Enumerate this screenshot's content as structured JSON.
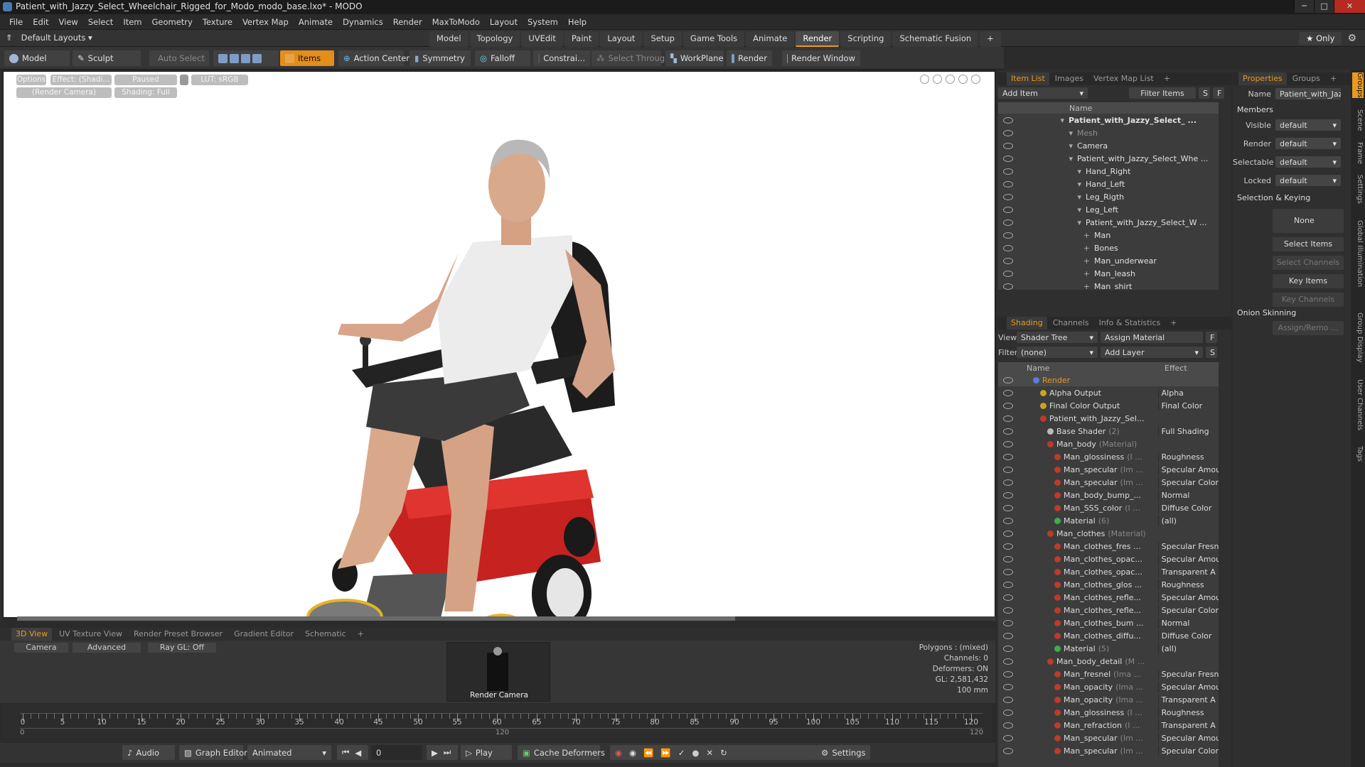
{
  "window": {
    "title": "Patient_with_Jazzy_Select_Wheelchair_Rigged_for_Modo_modo_base.lxo* - MODO",
    "min": "─",
    "max": "□",
    "close": "✕"
  },
  "menu": [
    "File",
    "Edit",
    "View",
    "Select",
    "Item",
    "Geometry",
    "Texture",
    "Vertex Map",
    "Animate",
    "Dynamics",
    "Render",
    "MaxToModo",
    "Layout",
    "System",
    "Help"
  ],
  "layoutbar": {
    "layouts_label": "Default Layouts ▾",
    "tabs": [
      "Model",
      "Topology",
      "UVEdit",
      "Paint",
      "Layout",
      "Setup",
      "Game Tools",
      "Animate",
      "Render",
      "Scripting",
      "Schematic Fusion"
    ],
    "active_tab": "Render",
    "add": "+",
    "only": "★ Only",
    "gear": "⚙"
  },
  "toolbar": {
    "model": "Model",
    "sculpt": "Sculpt",
    "auto_select": "Auto Select",
    "items": "Items",
    "action_center": "Action Center",
    "symmetry": "Symmetry",
    "falloff": "Falloff",
    "constraints": "Constrai...",
    "select_through": "Select Through",
    "workplane": "WorkPlane",
    "render": "Render",
    "render_window": "Render Window"
  },
  "viewport": {
    "tags": [
      "Options",
      "Effect: (Shadi...",
      "Paused",
      "LUT: sRGB",
      "(Render Camera)",
      "Shading: Full"
    ]
  },
  "bottom_tabs": [
    "3D View",
    "UV Texture View",
    "Render Preset Browser",
    "Gradient Editor",
    "Schematic",
    "+"
  ],
  "bottom_view": {
    "camera": "Camera",
    "advanced": "Advanced",
    "raygl": "Ray GL: Off",
    "thumb_label": "Render Camera",
    "stats": [
      "Polygons : (mixed)",
      "Channels: 0",
      "Deformers: ON",
      "GL: 2,581,432",
      "100 mm"
    ]
  },
  "timeline": {
    "ticks": [
      0,
      5,
      10,
      15,
      20,
      25,
      30,
      35,
      40,
      45,
      50,
      55,
      60,
      65,
      70,
      75,
      80,
      85,
      90,
      95,
      100,
      105,
      110,
      115,
      120
    ],
    "sub_start": "0",
    "sub_mid": "120",
    "sub_end": "120"
  },
  "transport": {
    "audio": "Audio",
    "graph_editor": "Graph Editor",
    "animated": "Animated",
    "frame": "0",
    "play": "Play",
    "cache_deformers": "Cache Deformers",
    "settings": "Settings"
  },
  "item_list": {
    "tabs": [
      "Item List",
      "Images",
      "Vertex Map List",
      "+"
    ],
    "add_item": "Add Item",
    "filter_items": "Filter Items",
    "s": "S",
    "f": "F",
    "header": "Name",
    "rows": [
      {
        "name": "Patient_with_Jazzy_Select_ ...",
        "bold": true,
        "indent": 0
      },
      {
        "name": "Mesh",
        "dim": true,
        "indent": 1
      },
      {
        "name": "Camera",
        "indent": 1
      },
      {
        "name": "Patient_with_Jazzy_Select_Whe ...",
        "indent": 1
      },
      {
        "name": "Hand_Right",
        "indent": 2
      },
      {
        "name": "Hand_Left",
        "indent": 2
      },
      {
        "name": "Leg_Rigth",
        "indent": 2
      },
      {
        "name": "Leg_Left",
        "indent": 2
      },
      {
        "name": "Patient_with_Jazzy_Select_W ...",
        "indent": 2
      },
      {
        "name": "Man",
        "indent": 3
      },
      {
        "name": "Bones",
        "indent": 3
      },
      {
        "name": "Man_underwear",
        "indent": 3
      },
      {
        "name": "Man_leash",
        "indent": 3
      },
      {
        "name": "Man_shirt",
        "indent": 3
      }
    ]
  },
  "shading": {
    "tabs": [
      "Shading",
      "Channels",
      "Info & Statistics",
      "+"
    ],
    "view_label": "View",
    "view_value": "Shader Tree",
    "assign_material": "Assign Material",
    "filter_label": "Filter",
    "filter_value": "(none)",
    "add_layer": "Add Layer",
    "col_name": "Name",
    "col_effect": "Effect",
    "rows": [
      {
        "name": "Render",
        "effect": "",
        "indent": 0,
        "dot": "#5a7fd6",
        "orange": true
      },
      {
        "name": "Alpha Output",
        "effect": "Alpha",
        "indent": 1,
        "dot": "#c9a227"
      },
      {
        "name": "Final Color Output",
        "effect": "Final Color",
        "indent": 1,
        "dot": "#c9a227"
      },
      {
        "name": "Patient_with_Jazzy_Sel...",
        "effect": "",
        "indent": 1,
        "dot": "#c0392b"
      },
      {
        "name": "Base Shader",
        "sub": "(2)",
        "effect": "Full Shading",
        "indent": 2,
        "dot": "#bbbbbb"
      },
      {
        "name": "Man_body",
        "sub": "(Material)",
        "effect": "",
        "indent": 2,
        "dot": "#c0392b"
      },
      {
        "name": "Man_glossiness",
        "sub": "(I ...",
        "effect": "Roughness",
        "indent": 3,
        "dot": "#c0392b"
      },
      {
        "name": "Man_specular",
        "sub": "(Im ...",
        "effect": "Specular Amou ...",
        "indent": 3,
        "dot": "#c0392b"
      },
      {
        "name": "Man_specular",
        "sub": "(Im ...",
        "effect": "Specular Color",
        "indent": 3,
        "dot": "#c0392b"
      },
      {
        "name": "Man_body_bump_...",
        "effect": "Normal",
        "indent": 3,
        "dot": "#c0392b"
      },
      {
        "name": "Man_SSS_color",
        "sub": "(I ...",
        "effect": "Diffuse Color",
        "indent": 3,
        "dot": "#c0392b"
      },
      {
        "name": "Material",
        "sub": "(6)",
        "effect": "(all)",
        "indent": 3,
        "dot": "#3fae4a"
      },
      {
        "name": "Man_clothes",
        "sub": "(Material)",
        "effect": "",
        "indent": 2,
        "dot": "#c0392b"
      },
      {
        "name": "Man_clothes_fres ...",
        "effect": "Specular Fresnel",
        "indent": 3,
        "dot": "#c0392b"
      },
      {
        "name": "Man_clothes_opac...",
        "effect": "Specular Amou ...",
        "indent": 3,
        "dot": "#c0392b"
      },
      {
        "name": "Man_clothes_opac...",
        "effect": "Transparent A ...",
        "indent": 3,
        "dot": "#c0392b"
      },
      {
        "name": "Man_clothes_glos ...",
        "effect": "Roughness",
        "indent": 3,
        "dot": "#c0392b"
      },
      {
        "name": "Man_clothes_refle...",
        "effect": "Specular Amou ...",
        "indent": 3,
        "dot": "#c0392b"
      },
      {
        "name": "Man_clothes_refle...",
        "effect": "Specular Color",
        "indent": 3,
        "dot": "#c0392b"
      },
      {
        "name": "Man_clothes_bum ...",
        "effect": "Normal",
        "indent": 3,
        "dot": "#c0392b"
      },
      {
        "name": "Man_clothes_diffu...",
        "effect": "Diffuse Color",
        "indent": 3,
        "dot": "#c0392b"
      },
      {
        "name": "Material",
        "sub": "(5)",
        "effect": "(all)",
        "indent": 3,
        "dot": "#3fae4a"
      },
      {
        "name": "Man_body_detail",
        "sub": "(M ...",
        "effect": "",
        "indent": 2,
        "dot": "#c0392b"
      },
      {
        "name": "Man_fresnel",
        "sub": "(Ima ...",
        "effect": "Specular Fresnel",
        "indent": 3,
        "dot": "#c0392b"
      },
      {
        "name": "Man_opacity",
        "sub": "(Ima ...",
        "effect": "Specular Amou ...",
        "indent": 3,
        "dot": "#c0392b"
      },
      {
        "name": "Man_opacity",
        "sub": "(Ima ...",
        "effect": "Transparent A ...",
        "indent": 3,
        "dot": "#c0392b"
      },
      {
        "name": "Man_glossiness",
        "sub": "(I ...",
        "effect": "Roughness",
        "indent": 3,
        "dot": "#c0392b"
      },
      {
        "name": "Man_refraction",
        "sub": "(I ...",
        "effect": "Transparent A ...",
        "indent": 3,
        "dot": "#c0392b"
      },
      {
        "name": "Man_specular",
        "sub": "(Im ...",
        "effect": "Specular Amou ...",
        "indent": 3,
        "dot": "#c0392b"
      },
      {
        "name": "Man_specular",
        "sub": "(Im ...",
        "effect": "Specular Color",
        "indent": 3,
        "dot": "#c0392b"
      }
    ]
  },
  "properties": {
    "tabs": [
      "Properties",
      "Groups",
      "+"
    ],
    "name_label": "Name",
    "name_value": "Patient_with_Jazzy",
    "members": "Members",
    "visible_label": "Visible",
    "visible_value": "default",
    "render_label": "Render",
    "render_value": "default",
    "selectable_label": "Selectable",
    "selectable_value": "default",
    "locked_label": "Locked",
    "locked_value": "default",
    "selection_keying": "Selection & Keying",
    "none": "None",
    "select_items": "Select Items",
    "select_channels": "Select Channels",
    "key_items": "Key Items",
    "key_channels": "Key Channels",
    "onion": "Onion Skinning",
    "assign_remove": "Assign/Remo ..."
  },
  "vtabs": [
    "Groups",
    "Scene",
    "Frame",
    "Settings",
    "Global Illumination",
    "Group Display",
    "User Channels",
    "Tags"
  ],
  "colors": {
    "accent": "#e89a21",
    "panel": "#2f2f2f",
    "viewport_bg": "#ffffff",
    "wheelchair_red": "#c6221f"
  }
}
